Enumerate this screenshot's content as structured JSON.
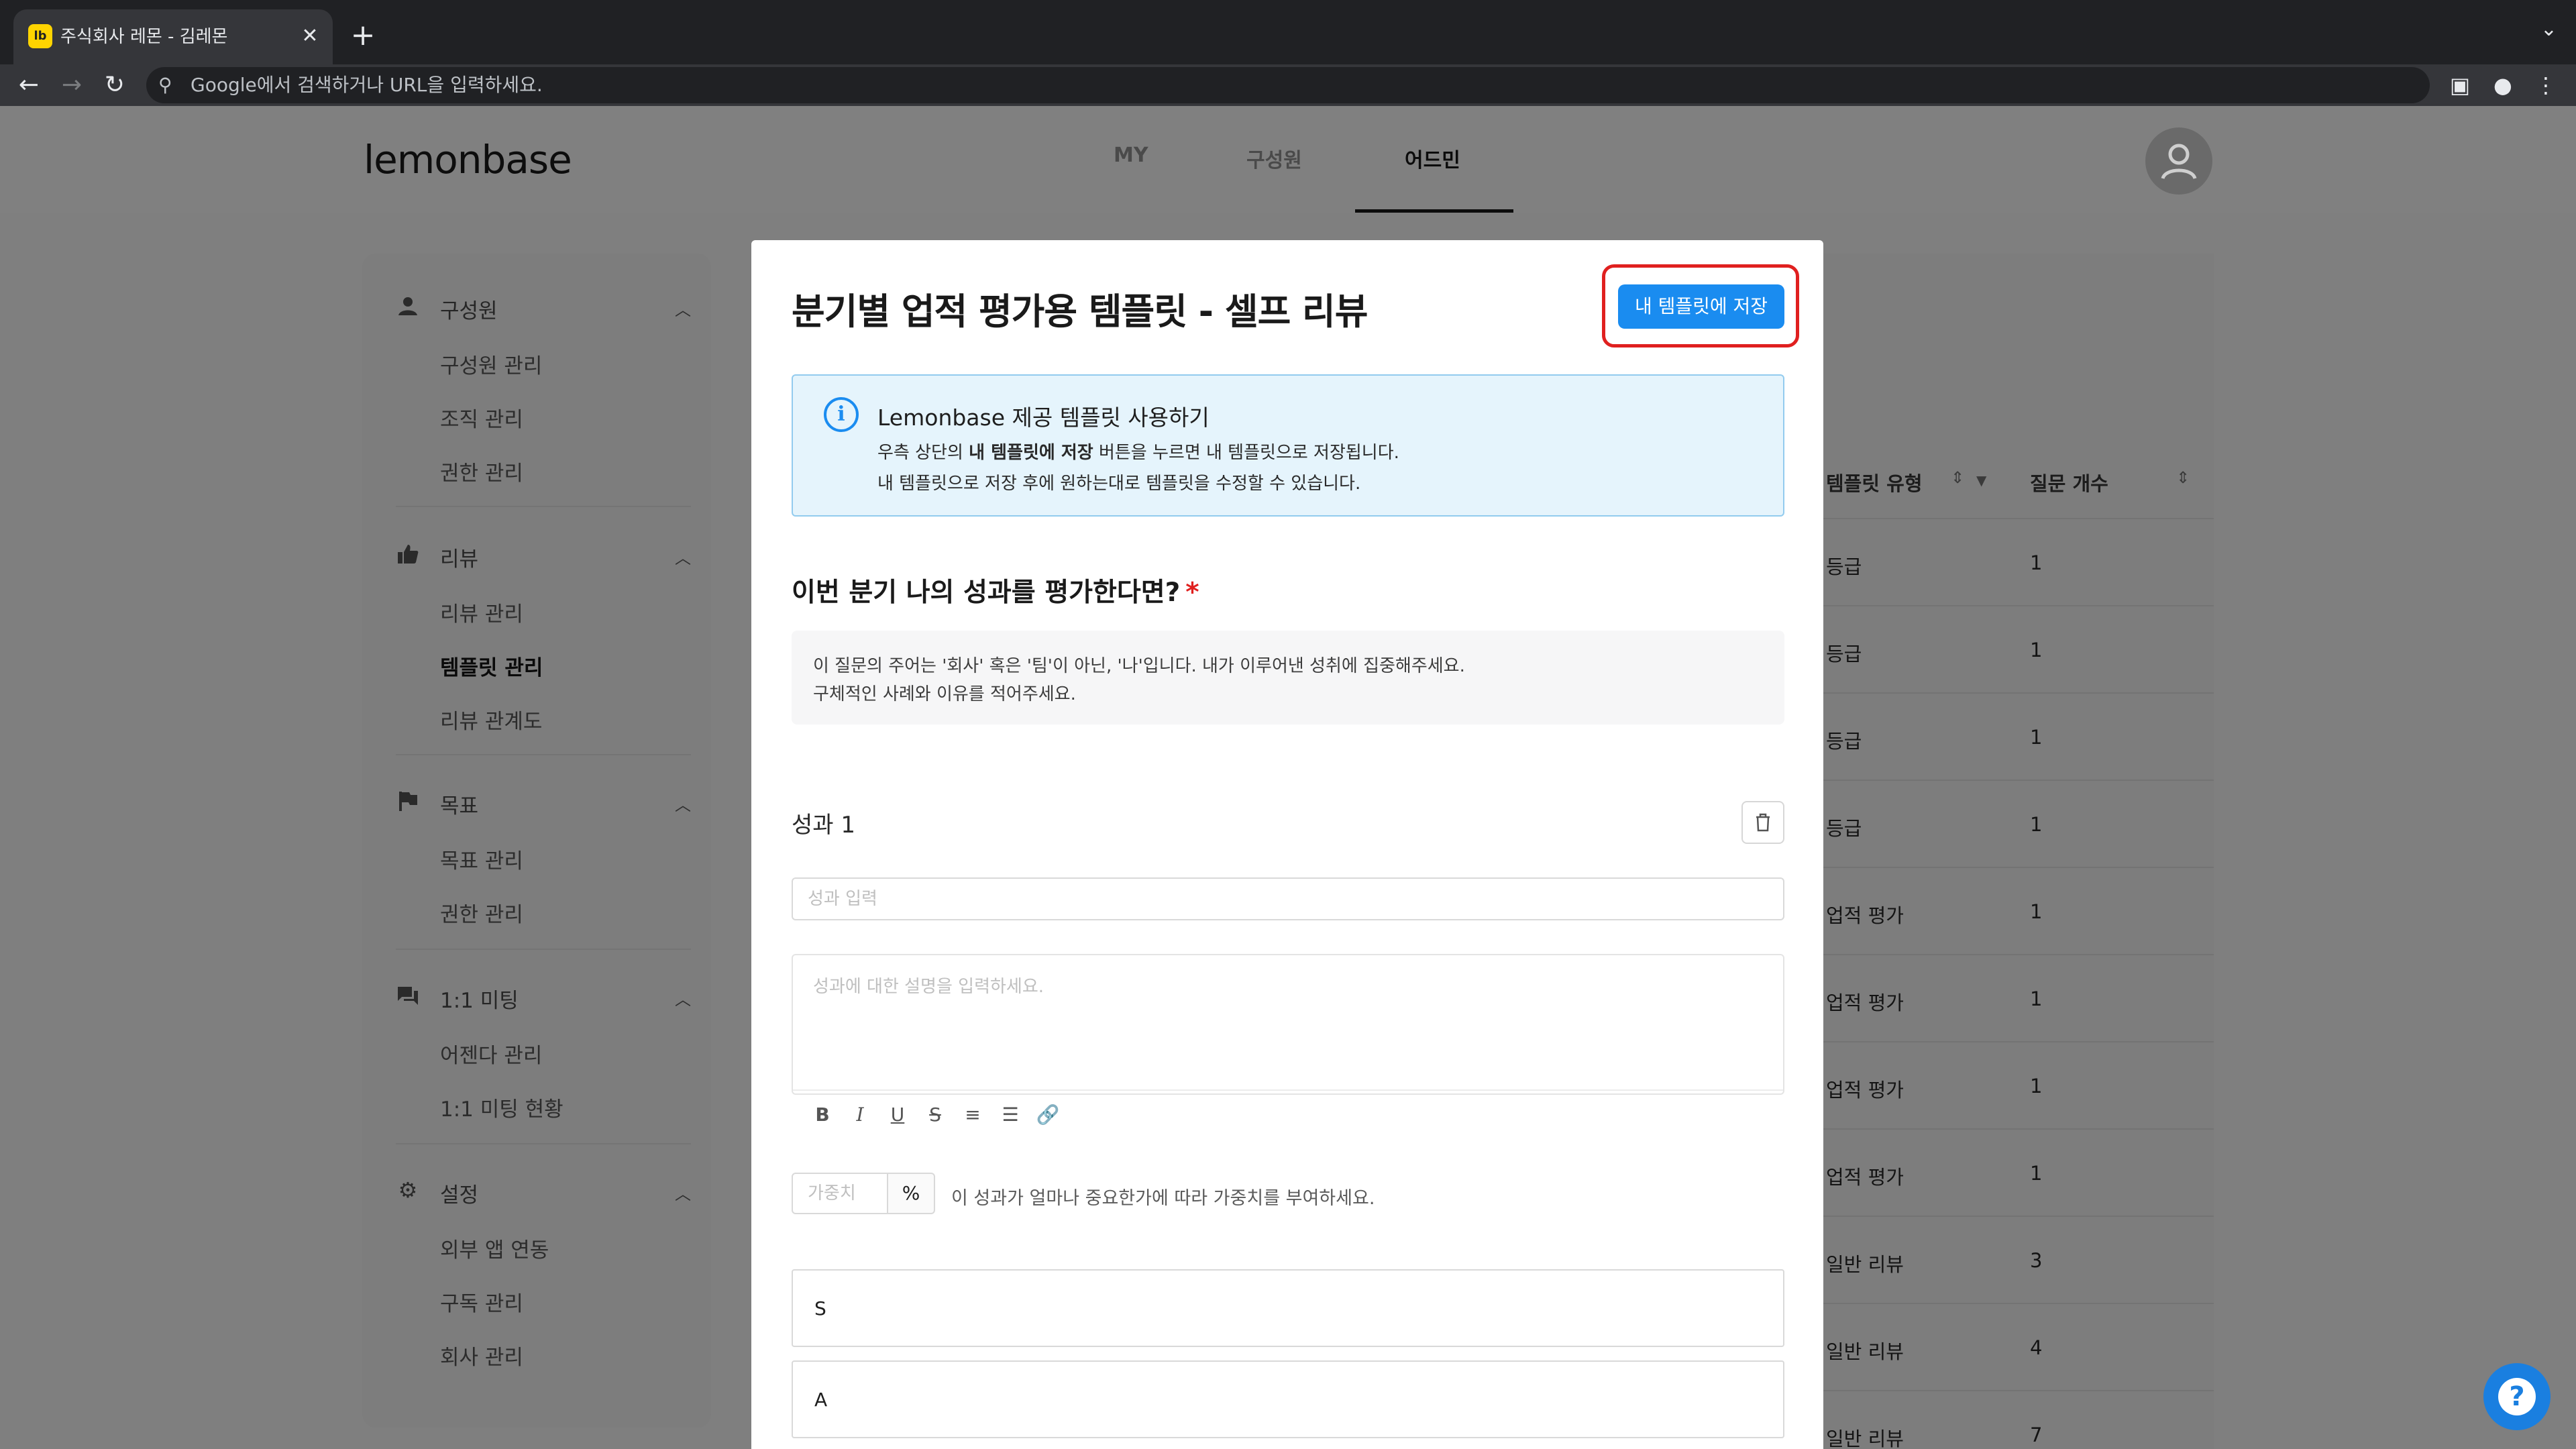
{
  "browser": {
    "tab_title": "주식회사 레몬 - 김레몬",
    "favicon_text": "lb",
    "close_glyph": "✕",
    "new_tab_glyph": "+",
    "dropdown_glyph": "⌄",
    "back_glyph": "←",
    "forward_glyph": "→",
    "reload_glyph": "↻",
    "omnibox_placeholder": "Google에서 검색하거나 URL을 입력하세요.",
    "search_glyph": "⚲",
    "sidepanel_glyph": "▣",
    "profile_glyph": "●",
    "menu_glyph": "⋮"
  },
  "header": {
    "logo": "lemonbase",
    "nav": [
      "MY",
      "구성원",
      "어드민"
    ],
    "active_nav": "어드민"
  },
  "sidebar": {
    "sections": [
      {
        "label": "구성원",
        "icon": "person-icon",
        "glyph": "👤",
        "items": [
          "구성원 관리",
          "조직 관리",
          "권한 관리"
        ]
      },
      {
        "label": "리뷰",
        "icon": "thumbs-up-icon",
        "glyph": "👍",
        "items": [
          "리뷰 관리",
          "템플릿 관리",
          "리뷰 관계도"
        ]
      },
      {
        "label": "목표",
        "icon": "flag-icon",
        "glyph": "⚑",
        "items": [
          "목표 관리",
          "권한 관리"
        ]
      },
      {
        "label": "1:1 미팅",
        "icon": "chat-icon",
        "glyph": "💬",
        "items": [
          "어젠다 관리",
          "1:1 미팅 현황"
        ]
      },
      {
        "label": "설정",
        "icon": "gear-icon",
        "glyph": "⚙",
        "items": [
          "외부 앱 연동",
          "구독 관리",
          "회사 관리"
        ]
      }
    ],
    "chevron_glyph": "︿",
    "active_item": "템플릿 관리"
  },
  "background_table": {
    "columns": [
      "템플릿 유형",
      "질문 개수"
    ],
    "sort_glyph": "⇕",
    "filter_glyph": "▼",
    "rows": [
      [
        "등급",
        "1"
      ],
      [
        "등급",
        "1"
      ],
      [
        "등급",
        "1"
      ],
      [
        "등급",
        "1"
      ],
      [
        "업적 평가",
        "1"
      ],
      [
        "업적 평가",
        "1"
      ],
      [
        "업적 평가",
        "1"
      ],
      [
        "업적 평가",
        "1"
      ],
      [
        "일반 리뷰",
        "3"
      ],
      [
        "일반 리뷰",
        "4"
      ],
      [
        "일반 리뷰",
        "7"
      ]
    ]
  },
  "modal": {
    "title": "분기별 업적 평가용 템플릿 - 셀프 리뷰",
    "save_button": "내 템플릿에 저장",
    "info": {
      "icon_glyph": "i",
      "title": "Lemonbase 제공 템플릿 사용하기",
      "line1_pre": "우측 상단의 ",
      "line1_bold": "내 템플릿에 저장",
      "line1_post": " 버튼을 누르면 내 템플릿으로 저장됩니다.",
      "line2": "내 템플릿으로 저장 후에 원하는대로 템플릿을 수정할 수 있습니다."
    },
    "question": "이번 분기 나의 성과를 평가한다면?",
    "required_mark": "*",
    "description": [
      "이 질문의 주어는 '회사' 혹은 '팀'이 아닌, '나'입니다. 내가 이루어낸 성취에 집중해주세요.",
      "구체적인 사례와 이유를 적어주세요."
    ],
    "item_title": "성과 1",
    "trash_glyph": "🗑",
    "title_placeholder": "성과 입력",
    "editor_placeholder": "성과에 대한 설명을 입력하세요.",
    "toolbar": [
      {
        "name": "bold-icon",
        "glyph": "B"
      },
      {
        "name": "italic-icon",
        "glyph": "I"
      },
      {
        "name": "underline-icon",
        "glyph": "U"
      },
      {
        "name": "strikethrough-icon",
        "glyph": "S"
      },
      {
        "name": "ordered-list-icon",
        "glyph": "≡"
      },
      {
        "name": "bullet-list-icon",
        "glyph": "☰"
      },
      {
        "name": "link-icon",
        "glyph": "🔗"
      }
    ],
    "weight_placeholder": "가중치",
    "weight_unit": "%",
    "weight_hint": "이 성과가 얼마나 중요한가에 따라 가중치를 부여하세요.",
    "grades": [
      "S",
      "A"
    ]
  },
  "help_glyph": "?",
  "colors": {
    "accent": "#1a8cf0",
    "highlight": "#e0201f",
    "info_bg": "#e5f4fc"
  }
}
